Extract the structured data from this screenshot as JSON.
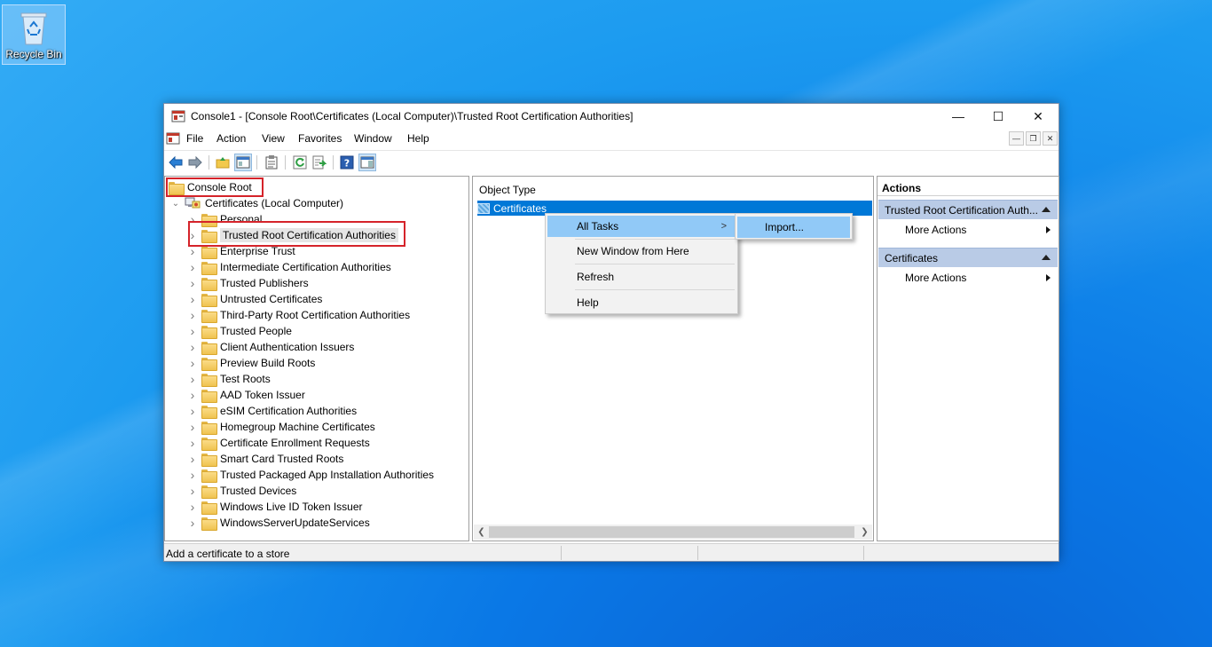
{
  "desktop": {
    "recycle_bin_label": "Recycle Bin"
  },
  "window": {
    "title": "Console1 - [Console Root\\Certificates (Local Computer)\\Trusted Root Certification Authorities]",
    "controls": {
      "minimize": "—",
      "maximize": "☐",
      "close": "✕"
    }
  },
  "menubar": {
    "items": [
      "File",
      "Action",
      "View",
      "Favorites",
      "Window",
      "Help"
    ]
  },
  "toolbar": {
    "icons": [
      "back-arrow-icon",
      "forward-arrow-icon",
      "up-folder-icon",
      "show-hide-console-tree-icon",
      "properties-icon",
      "refresh-icon",
      "export-list-icon",
      "help-icon",
      "show-hide-action-pane-icon"
    ]
  },
  "tree": {
    "root": "Console Root",
    "computer": "Certificates (Local Computer)",
    "stores": [
      "Personal",
      "Trusted Root Certification Authorities",
      "Enterprise Trust",
      "Intermediate Certification Authorities",
      "Trusted Publishers",
      "Untrusted Certificates",
      "Third-Party Root Certification Authorities",
      "Trusted People",
      "Client Authentication Issuers",
      "Preview Build Roots",
      "Test Roots",
      "AAD Token Issuer",
      "eSIM Certification Authorities",
      "Homegroup Machine Certificates",
      "Certificate Enrollment Requests",
      "Smart Card Trusted Roots",
      "Trusted Packaged App Installation Authorities",
      "Trusted Devices",
      "Windows Live ID Token Issuer",
      "WindowsServerUpdateServices"
    ],
    "selected": "Trusted Root Certification Authorities"
  },
  "middle": {
    "column_header": "Object Type",
    "selected_item": "Certificates"
  },
  "actions_pane": {
    "header": "Actions",
    "sections": [
      {
        "title": "Trusted Root Certification Auth...",
        "item": "More Actions"
      },
      {
        "title": "Certificates",
        "item": "More Actions"
      }
    ]
  },
  "context_menu": {
    "items": [
      "All Tasks",
      "New Window from Here",
      "Refresh",
      "Help"
    ],
    "submenu_arrow": ">",
    "submenu": {
      "items": [
        "Import..."
      ]
    }
  },
  "status_bar": {
    "text": "Add a certificate to a store"
  }
}
